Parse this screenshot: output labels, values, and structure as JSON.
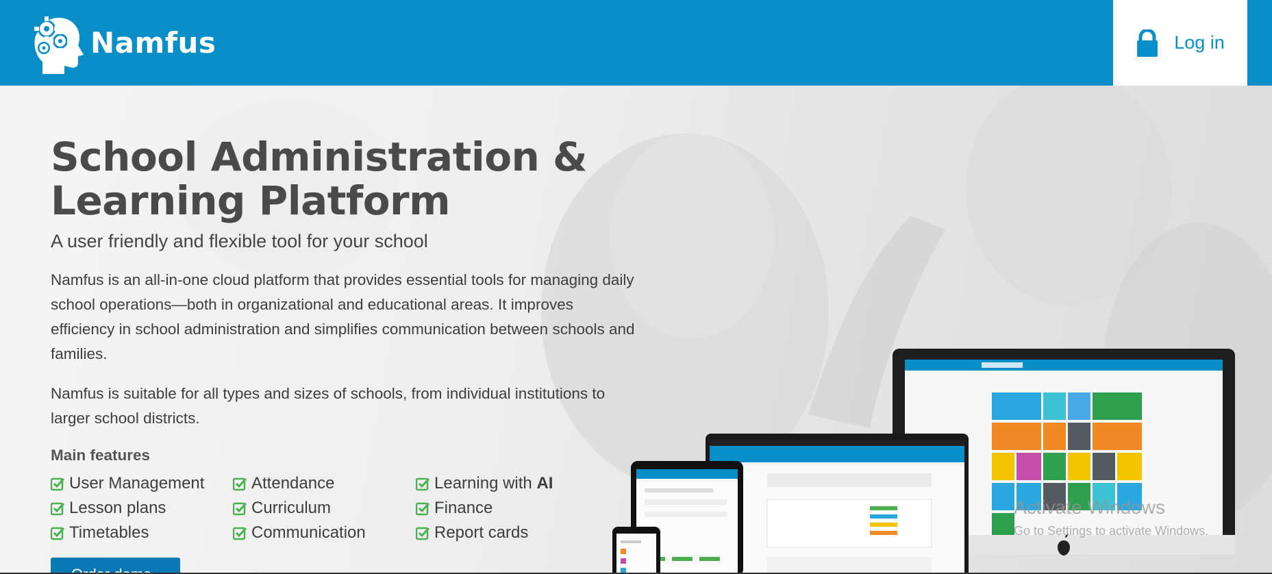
{
  "header": {
    "brand": "Namfus",
    "login_label": "Log in"
  },
  "hero": {
    "title": "School Administration & Learning Platform",
    "subtitle": "A user friendly and flexible tool for your school",
    "paragraph1": "Namfus is an all-in-one cloud platform that provides essential tools for managing daily school operations—both in organizational and educational areas. It improves efficiency in school administration and simplifies communication between schools and families.",
    "paragraph2": "Namfus is suitable for all types and sizes of schools, from individual institutions to larger school districts.",
    "features_title": "Main features",
    "features": [
      "User Management",
      "Attendance",
      "Learning with",
      "Lesson plans",
      "Curriculum",
      "Finance",
      "Timetables",
      "Communication",
      "Report cards"
    ],
    "features_ai_suffix": "AI",
    "cta_label": "Order demo"
  },
  "watermark": {
    "title": "Activate Windows",
    "subtitle": "Go to Settings to activate Windows."
  },
  "colors": {
    "brand_blue": "#0a8ec8",
    "check_green": "#4caf50",
    "text_dark": "#444444"
  },
  "icons": [
    "gear-head-logo-icon",
    "lock-icon",
    "check-square-icon",
    "apple-icon"
  ]
}
